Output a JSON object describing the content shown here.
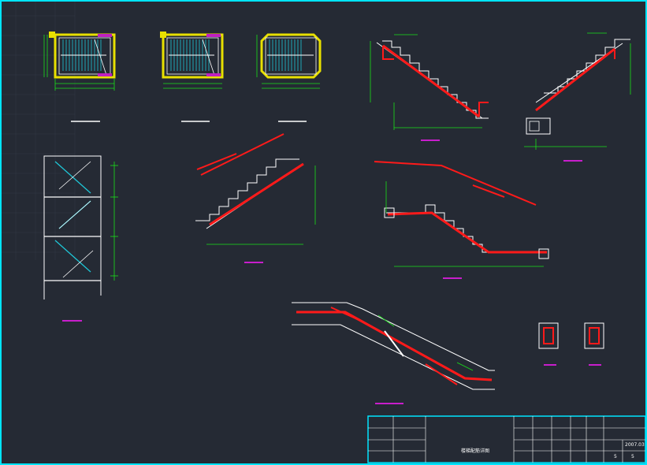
{
  "drawing": {
    "background": "#252a34",
    "frame_color": "#00e5ff",
    "colors": {
      "outline": "#ffffff",
      "dimension": "#19e019",
      "rebar": "#ff1a1a",
      "stair_tread": "#1ec8d8",
      "wall": "#e8e000",
      "tag": "#ff1aff",
      "grid": "#3a4150"
    }
  },
  "title_block": {
    "drawing_name": "楼梯配筋详图",
    "date": "2007.03",
    "sheet_no": "5",
    "sheet_total": "5"
  }
}
